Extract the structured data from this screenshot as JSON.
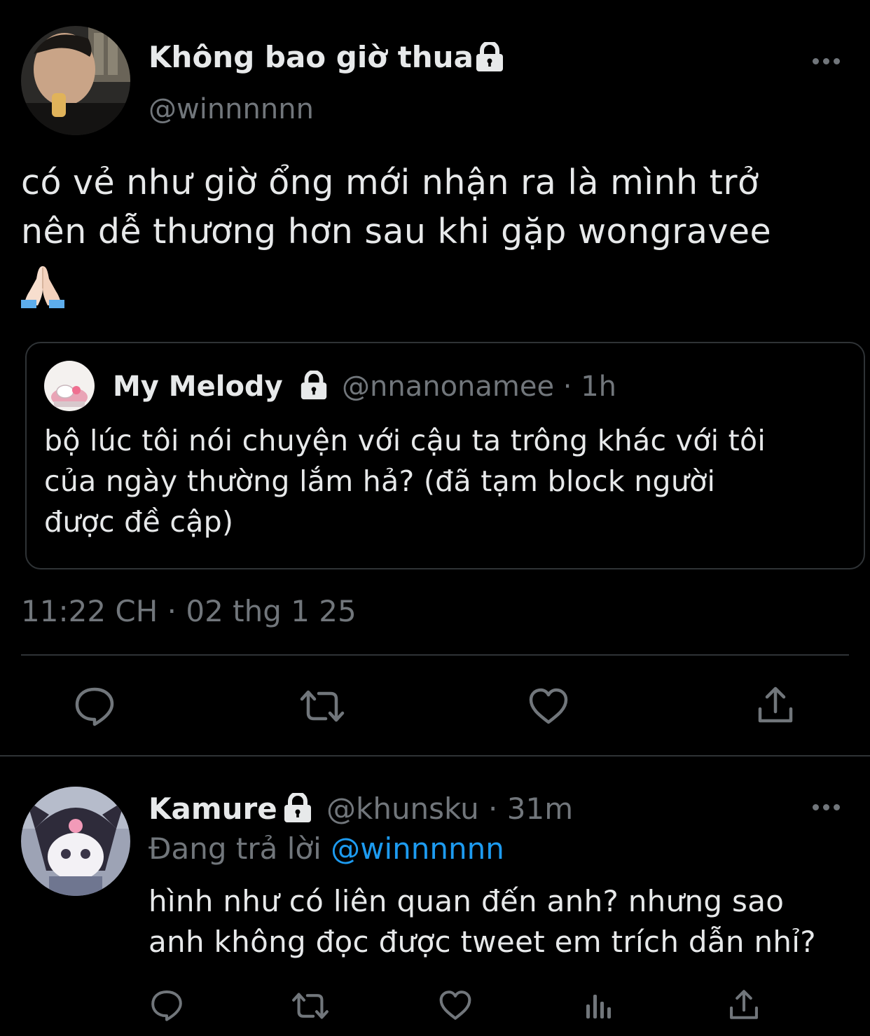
{
  "main_tweet": {
    "display_name": "Không bao giờ thua",
    "handle": "@winnnnnn",
    "text_lines": [
      "có vẻ như giờ ổng mới nhận ra là mình trở",
      "nên dễ thương hơn sau khi gặp wongravee"
    ],
    "emoji": "🙏🏻",
    "timestamp": "11:22 CH · 02 thg 1 25",
    "icons": [
      "lock-icon",
      "more-icon",
      "reply-icon",
      "retweet-icon",
      "like-icon",
      "share-icon"
    ]
  },
  "quote": {
    "display_name": "My Melody",
    "handle_time": "@nnanonamee · 1h",
    "text_lines": [
      "bộ lúc tôi nói chuyện với cậu ta trông khác với tôi",
      "của ngày thường lắm hả? (đã tạm block người",
      "được đề cập)"
    ]
  },
  "reply": {
    "display_name": "Kamure",
    "handle_time": "@khunsku · 31m",
    "replying_prefix": "Đang trả lời",
    "replying_to": "@winnnnnn",
    "text_lines": [
      "hình như có liên quan đến anh? nhưng sao",
      "anh không đọc được tweet em trích dẫn nhỉ?"
    ],
    "icons": [
      "reply-icon",
      "retweet-icon",
      "like-icon",
      "analytics-icon",
      "share-icon"
    ]
  },
  "colors": {
    "background": "#000000",
    "text": "#E7E9EA",
    "muted": "#71767B",
    "accent": "#1D9BF0",
    "border": "#2F3336"
  }
}
